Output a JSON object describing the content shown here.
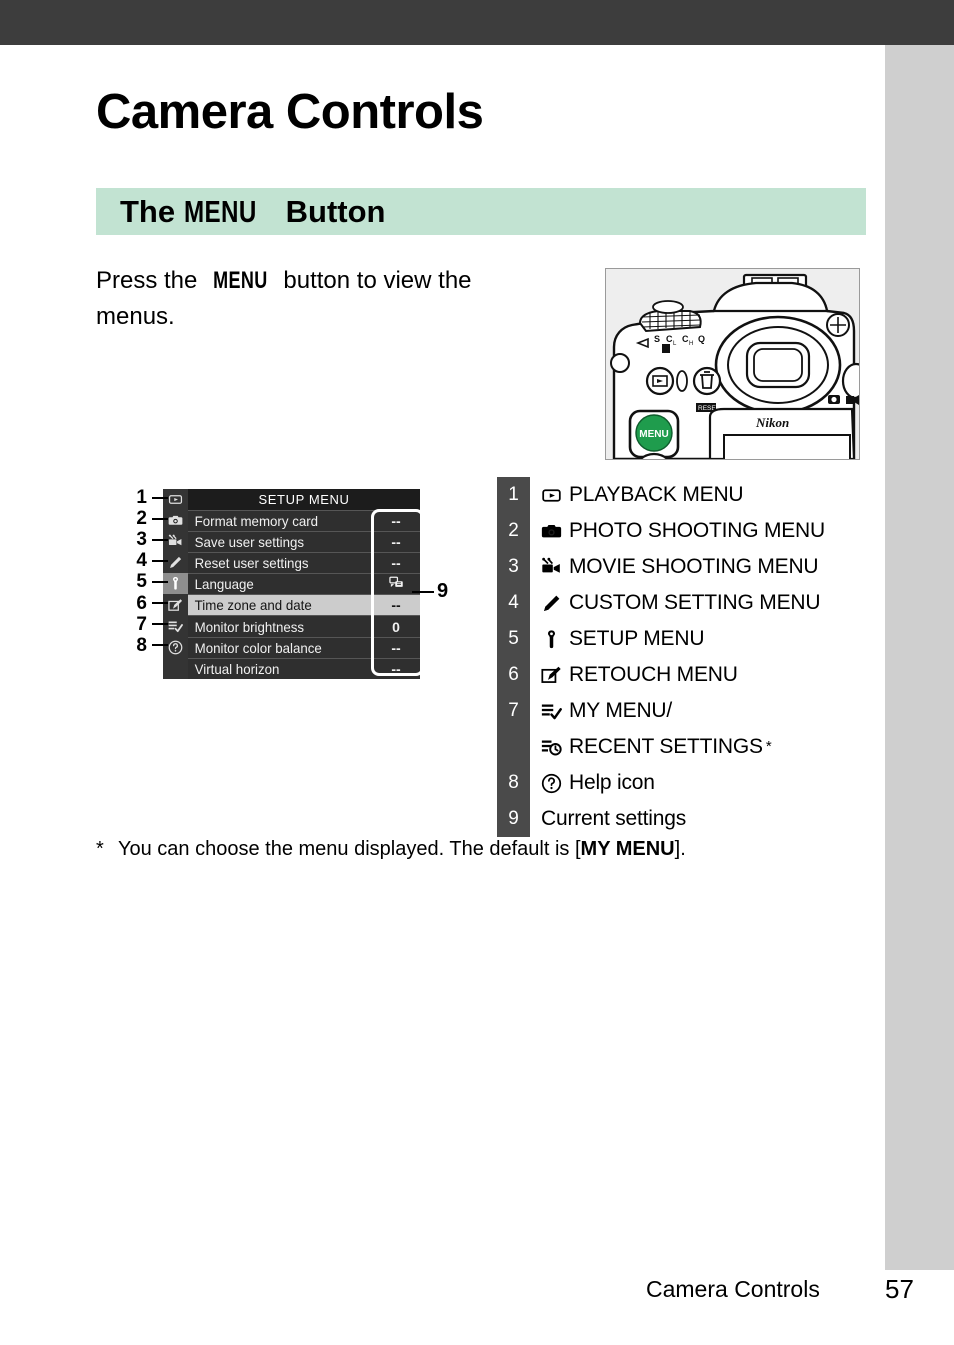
{
  "page": {
    "title": "Camera Controls",
    "section_title_pre": "The ",
    "section_title_menu": "MENU",
    "section_title_post": " Button",
    "intro_pre": "Press the ",
    "intro_menu": "MENU",
    "intro_post": " button to view the menus.",
    "footnote_star": "*",
    "footnote_pre": "You can choose the menu displayed. The default is [",
    "footnote_bold": "MY MENU",
    "footnote_post": "].",
    "footer_chapter": "Camera Controls",
    "footer_page": "57"
  },
  "colors": {
    "header_bar": "#3d3d3d",
    "right_strip": "#cfcfcf",
    "section_band": "#c2e3d2",
    "badge": "#4a4a4a",
    "menu_bg": "#1c1c1c",
    "menu_row": "#2f2f2f",
    "menu_selected": "#cccccc",
    "menu_tab_active": "#8e8e8e",
    "menu_button_green": "#1f9c4d"
  },
  "camera_figure": {
    "name": "nikon-dslr-top-rear-view",
    "brand_text": "Nikon",
    "menu_button_label": "MENU",
    "release_mode_marks": "S CL CH Q",
    "reset_label": "RESET"
  },
  "menu_screen": {
    "header": "SETUP MENU",
    "tabs": [
      {
        "icon": "playback-icon",
        "glyph": "playback",
        "active": false
      },
      {
        "icon": "photo-shooting-icon",
        "glyph": "camera",
        "active": false
      },
      {
        "icon": "movie-shooting-icon",
        "glyph": "movie",
        "active": false
      },
      {
        "icon": "custom-setting-icon",
        "glyph": "pencil",
        "active": false
      },
      {
        "icon": "setup-icon",
        "glyph": "wrench",
        "active": true
      },
      {
        "icon": "retouch-icon",
        "glyph": "retouch",
        "active": false
      },
      {
        "icon": "my-menu-icon",
        "glyph": "mymenu",
        "active": false
      },
      {
        "icon": "help-icon",
        "glyph": "question",
        "active": false
      }
    ],
    "rows": [
      {
        "label": "Format memory card",
        "value": "--",
        "value_icon": "",
        "selected": false
      },
      {
        "label": "Save user settings",
        "value": "--",
        "value_icon": "",
        "selected": false
      },
      {
        "label": "Reset user settings",
        "value": "--",
        "value_icon": "",
        "selected": false
      },
      {
        "label": "Language",
        "value": "",
        "value_icon": "language-icon",
        "selected": false
      },
      {
        "label": "Time zone and date",
        "value": "--",
        "value_icon": "",
        "selected": true
      },
      {
        "label": "Monitor brightness",
        "value": "0",
        "value_icon": "",
        "selected": false
      },
      {
        "label": "Monitor color balance",
        "value": "--",
        "value_icon": "",
        "selected": false
      },
      {
        "label": "Virtual horizon",
        "value": "--",
        "value_icon": "",
        "selected": false
      }
    ]
  },
  "left_callouts": [
    "1",
    "2",
    "3",
    "4",
    "5",
    "6",
    "7",
    "8"
  ],
  "right_callout": {
    "number": "9"
  },
  "legend": [
    {
      "num": "1",
      "icon": "playback-icon",
      "label": "PLAYBACK MENU",
      "star": false
    },
    {
      "num": "2",
      "icon": "photo-shooting-icon",
      "label": "PHOTO SHOOTING MENU",
      "star": false
    },
    {
      "num": "3",
      "icon": "movie-shooting-icon",
      "label": "MOVIE SHOOTING MENU",
      "star": false
    },
    {
      "num": "4",
      "icon": "custom-setting-icon",
      "label": "CUSTOM SETTING MENU",
      "star": false
    },
    {
      "num": "5",
      "icon": "setup-icon",
      "label": "SETUP MENU",
      "star": false
    },
    {
      "num": "6",
      "icon": "retouch-icon",
      "label": "RETOUCH MENU",
      "star": false
    },
    {
      "num": "7",
      "icon": "my-menu-icon",
      "label": "MY MENU/",
      "star": false,
      "second_icon": "recent-settings-icon",
      "second_label": "RECENT SETTINGS",
      "second_star": "*"
    },
    {
      "num": "8",
      "icon": "help-circle-icon",
      "label": "Help icon",
      "star": false
    },
    {
      "num": "9",
      "icon": "",
      "label": "Current settings",
      "star": false
    }
  ]
}
